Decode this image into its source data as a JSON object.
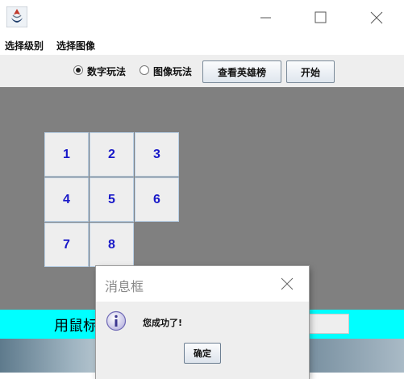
{
  "menubar": {
    "items": [
      "选择级别",
      "选择图像"
    ]
  },
  "toolbar": {
    "radio_number": {
      "label": "数字玩法",
      "checked": true
    },
    "radio_image": {
      "label": "图像玩法",
      "checked": false
    },
    "leaderboard_label": "查看英雄榜",
    "start_label": "开始"
  },
  "puzzle": {
    "tiles": [
      "1",
      "2",
      "3",
      "4",
      "5",
      "6",
      "7",
      "8"
    ]
  },
  "status_bar": {
    "hint_visible": "用鼠标"
  },
  "dialog": {
    "title": "消息框",
    "message": "您成功了!",
    "ok_label": "确定"
  },
  "colors": {
    "game_background": "#808080",
    "status_bar": "#00ffff",
    "tile_text": "#1818c8"
  }
}
